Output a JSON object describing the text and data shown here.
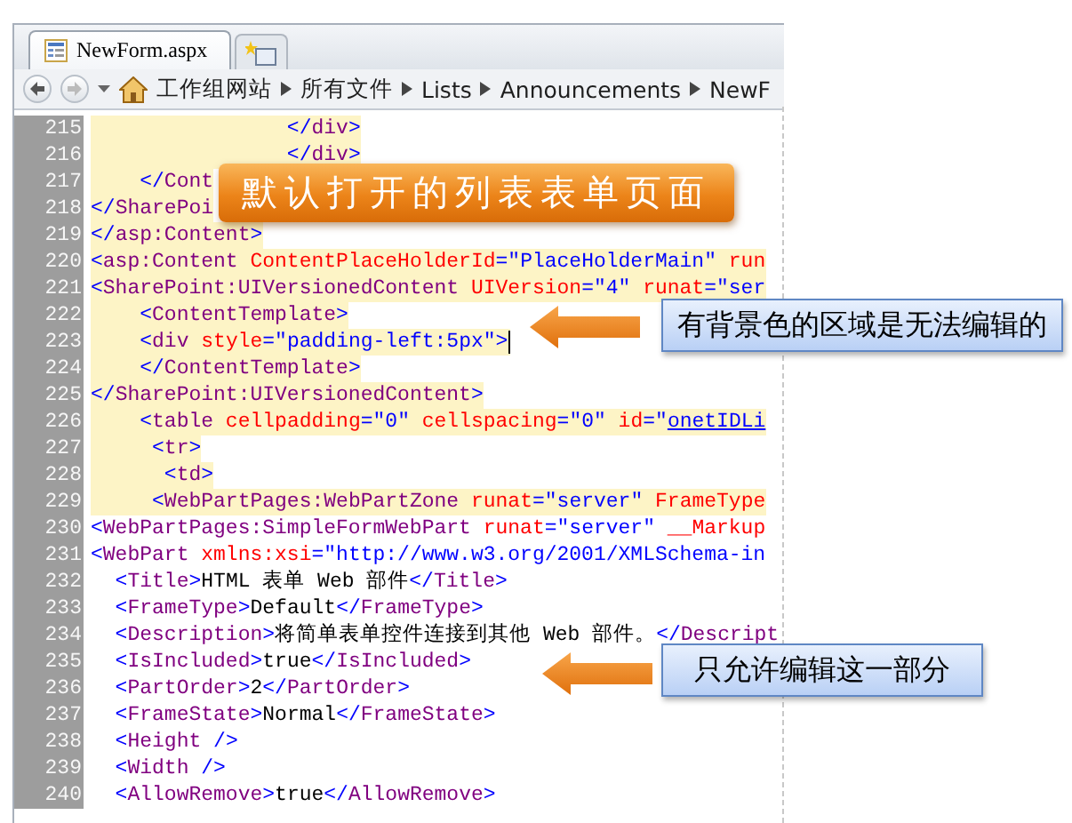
{
  "tabs": [
    {
      "label": "NewForm.aspx",
      "selected": true
    }
  ],
  "breadcrumb": [
    "工作组网站",
    "所有文件",
    "Lists",
    "Announcements",
    "NewF"
  ],
  "lines": [
    {
      "number": "215",
      "locked": true,
      "caret": false,
      "tokens": [
        {
          "kind": "bracket",
          "text": "                </"
        },
        {
          "kind": "tag",
          "text": "div"
        },
        {
          "kind": "bracket",
          "text": ">"
        }
      ]
    },
    {
      "number": "216",
      "locked": true,
      "caret": false,
      "tokens": [
        {
          "kind": "bracket",
          "text": "                </"
        },
        {
          "kind": "tag",
          "text": "div"
        },
        {
          "kind": "bracket",
          "text": ">"
        }
      ]
    },
    {
      "number": "217",
      "locked": true,
      "caret": false,
      "tokens": [
        {
          "kind": "bracket",
          "text": "    </"
        },
        {
          "kind": "tag",
          "text": "Cont"
        }
      ]
    },
    {
      "number": "218",
      "locked": true,
      "caret": false,
      "tokens": [
        {
          "kind": "bracket",
          "text": "</"
        },
        {
          "kind": "tag",
          "text": "SharePoi"
        }
      ]
    },
    {
      "number": "219",
      "locked": true,
      "caret": false,
      "tokens": [
        {
          "kind": "bracket",
          "text": "</"
        },
        {
          "kind": "tag",
          "text": "asp:Content"
        },
        {
          "kind": "bracket",
          "text": ">"
        }
      ]
    },
    {
      "number": "220",
      "locked": true,
      "caret": false,
      "tokens": [
        {
          "kind": "bracket",
          "text": "<"
        },
        {
          "kind": "tag",
          "text": "asp:Content"
        },
        {
          "kind": "attr",
          "text": " ContentPlaceHolderId"
        },
        {
          "kind": "value",
          "text": "=\"PlaceHolderMain\""
        },
        {
          "kind": "attr",
          "text": " run"
        }
      ]
    },
    {
      "number": "221",
      "locked": true,
      "caret": false,
      "tokens": [
        {
          "kind": "bracket",
          "text": "<"
        },
        {
          "kind": "tag",
          "text": "SharePoint:UIVersionedContent"
        },
        {
          "kind": "attr",
          "text": " UIVersion"
        },
        {
          "kind": "value",
          "text": "=\"4\""
        },
        {
          "kind": "attr",
          "text": " runat"
        },
        {
          "kind": "value",
          "text": "=\"ser"
        }
      ]
    },
    {
      "number": "222",
      "locked": true,
      "caret": false,
      "tokens": [
        {
          "kind": "bracket",
          "text": "    <"
        },
        {
          "kind": "tag",
          "text": "ContentTemplate"
        },
        {
          "kind": "bracket",
          "text": ">"
        }
      ]
    },
    {
      "number": "223",
      "locked": true,
      "caret": true,
      "tokens": [
        {
          "kind": "bracket",
          "text": "    <"
        },
        {
          "kind": "tag",
          "text": "div"
        },
        {
          "kind": "attr",
          "text": " style"
        },
        {
          "kind": "value",
          "text": "=\"padding-left:5px\""
        },
        {
          "kind": "bracket",
          "text": ">"
        }
      ]
    },
    {
      "number": "224",
      "locked": true,
      "caret": false,
      "tokens": [
        {
          "kind": "bracket",
          "text": "    </"
        },
        {
          "kind": "tag",
          "text": "ContentTemplate"
        },
        {
          "kind": "bracket",
          "text": ">"
        }
      ]
    },
    {
      "number": "225",
      "locked": true,
      "caret": false,
      "tokens": [
        {
          "kind": "bracket",
          "text": "</"
        },
        {
          "kind": "tag",
          "text": "SharePoint:UIVersionedContent"
        },
        {
          "kind": "bracket",
          "text": ">"
        }
      ]
    },
    {
      "number": "226",
      "locked": true,
      "caret": false,
      "tokens": [
        {
          "kind": "bracket",
          "text": "    <"
        },
        {
          "kind": "tag",
          "text": "table"
        },
        {
          "kind": "attr",
          "text": " cellpadding"
        },
        {
          "kind": "value",
          "text": "=\"0\""
        },
        {
          "kind": "attr",
          "text": " cellspacing"
        },
        {
          "kind": "value",
          "text": "=\"0\""
        },
        {
          "kind": "attr",
          "text": " id"
        },
        {
          "kind": "value",
          "text": "=\""
        },
        {
          "kind": "link",
          "text": "onetIDLi"
        }
      ]
    },
    {
      "number": "227",
      "locked": true,
      "caret": false,
      "tokens": [
        {
          "kind": "bracket",
          "text": "     <"
        },
        {
          "kind": "tag",
          "text": "tr"
        },
        {
          "kind": "bracket",
          "text": ">"
        }
      ]
    },
    {
      "number": "228",
      "locked": true,
      "caret": false,
      "tokens": [
        {
          "kind": "bracket",
          "text": "      <"
        },
        {
          "kind": "tag",
          "text": "td"
        },
        {
          "kind": "bracket",
          "text": ">"
        }
      ]
    },
    {
      "number": "229",
      "locked": true,
      "caret": false,
      "tokens": [
        {
          "kind": "bracket",
          "text": "     <"
        },
        {
          "kind": "tag",
          "text": "WebPartPages:WebPartZone"
        },
        {
          "kind": "attr",
          "text": " runat"
        },
        {
          "kind": "value",
          "text": "=\"server\""
        },
        {
          "kind": "attr",
          "text": " FrameType"
        }
      ]
    },
    {
      "number": "230",
      "locked": false,
      "caret": false,
      "tokens": [
        {
          "kind": "bracket",
          "text": "<"
        },
        {
          "kind": "tag",
          "text": "WebPartPages:SimpleFormWebPart"
        },
        {
          "kind": "attr",
          "text": " runat"
        },
        {
          "kind": "value",
          "text": "=\"server\""
        },
        {
          "kind": "attr",
          "text": " __Markup"
        }
      ]
    },
    {
      "number": "231",
      "locked": false,
      "caret": false,
      "tokens": [
        {
          "kind": "bracket",
          "text": "<"
        },
        {
          "kind": "tag",
          "text": "WebPart"
        },
        {
          "kind": "attr",
          "text": " xmlns:xsi"
        },
        {
          "kind": "value",
          "text": "=\"http://www.w3.org/2001/XMLSchema-in"
        }
      ]
    },
    {
      "number": "232",
      "locked": false,
      "caret": false,
      "tokens": [
        {
          "kind": "bracket",
          "text": "  <"
        },
        {
          "kind": "tag",
          "text": "Title"
        },
        {
          "kind": "bracket",
          "text": ">"
        },
        {
          "kind": "text",
          "text": "HTML 表单 Web 部件"
        },
        {
          "kind": "bracket",
          "text": "</"
        },
        {
          "kind": "tag",
          "text": "Title"
        },
        {
          "kind": "bracket",
          "text": ">"
        }
      ]
    },
    {
      "number": "233",
      "locked": false,
      "caret": false,
      "tokens": [
        {
          "kind": "bracket",
          "text": "  <"
        },
        {
          "kind": "tag",
          "text": "FrameType"
        },
        {
          "kind": "bracket",
          "text": ">"
        },
        {
          "kind": "text",
          "text": "Default"
        },
        {
          "kind": "bracket",
          "text": "</"
        },
        {
          "kind": "tag",
          "text": "FrameType"
        },
        {
          "kind": "bracket",
          "text": ">"
        }
      ]
    },
    {
      "number": "234",
      "locked": false,
      "caret": false,
      "tokens": [
        {
          "kind": "bracket",
          "text": "  <"
        },
        {
          "kind": "tag",
          "text": "Description"
        },
        {
          "kind": "bracket",
          "text": ">"
        },
        {
          "kind": "text",
          "text": "将简单表单控件连接到其他 Web 部件。"
        },
        {
          "kind": "bracket",
          "text": "</"
        },
        {
          "kind": "tag",
          "text": "Descript"
        }
      ]
    },
    {
      "number": "235",
      "locked": false,
      "caret": false,
      "tokens": [
        {
          "kind": "bracket",
          "text": "  <"
        },
        {
          "kind": "tag",
          "text": "IsIncluded"
        },
        {
          "kind": "bracket",
          "text": ">"
        },
        {
          "kind": "text",
          "text": "true"
        },
        {
          "kind": "bracket",
          "text": "</"
        },
        {
          "kind": "tag",
          "text": "IsIncluded"
        },
        {
          "kind": "bracket",
          "text": ">"
        }
      ]
    },
    {
      "number": "236",
      "locked": false,
      "caret": false,
      "tokens": [
        {
          "kind": "bracket",
          "text": "  <"
        },
        {
          "kind": "tag",
          "text": "PartOrder"
        },
        {
          "kind": "bracket",
          "text": ">"
        },
        {
          "kind": "text",
          "text": "2"
        },
        {
          "kind": "bracket",
          "text": "</"
        },
        {
          "kind": "tag",
          "text": "PartOrder"
        },
        {
          "kind": "bracket",
          "text": ">"
        }
      ]
    },
    {
      "number": "237",
      "locked": false,
      "caret": false,
      "tokens": [
        {
          "kind": "bracket",
          "text": "  <"
        },
        {
          "kind": "tag",
          "text": "FrameState"
        },
        {
          "kind": "bracket",
          "text": ">"
        },
        {
          "kind": "text",
          "text": "Normal"
        },
        {
          "kind": "bracket",
          "text": "</"
        },
        {
          "kind": "tag",
          "text": "FrameState"
        },
        {
          "kind": "bracket",
          "text": ">"
        }
      ]
    },
    {
      "number": "238",
      "locked": false,
      "caret": false,
      "tokens": [
        {
          "kind": "bracket",
          "text": "  <"
        },
        {
          "kind": "tag",
          "text": "Height"
        },
        {
          "kind": "bracket",
          "text": " />"
        }
      ]
    },
    {
      "number": "239",
      "locked": false,
      "caret": false,
      "tokens": [
        {
          "kind": "bracket",
          "text": "  <"
        },
        {
          "kind": "tag",
          "text": "Width"
        },
        {
          "kind": "bracket",
          "text": " />"
        }
      ]
    },
    {
      "number": "240",
      "locked": false,
      "caret": false,
      "tokens": [
        {
          "kind": "bracket",
          "text": "  <"
        },
        {
          "kind": "tag",
          "text": "AllowRemove"
        },
        {
          "kind": "bracket",
          "text": ">"
        },
        {
          "kind": "text",
          "text": "true"
        },
        {
          "kind": "bracket",
          "text": "</"
        },
        {
          "kind": "tag",
          "text": "AllowRemove"
        },
        {
          "kind": "bracket",
          "text": ">"
        }
      ]
    }
  ],
  "callouts": [
    {
      "kind": "banner",
      "text": "默认打开的列表表单页面"
    },
    {
      "kind": "note",
      "text": "有背景色的区域是无法编辑的"
    },
    {
      "kind": "note",
      "text": "只允许编辑这一部分"
    }
  ]
}
